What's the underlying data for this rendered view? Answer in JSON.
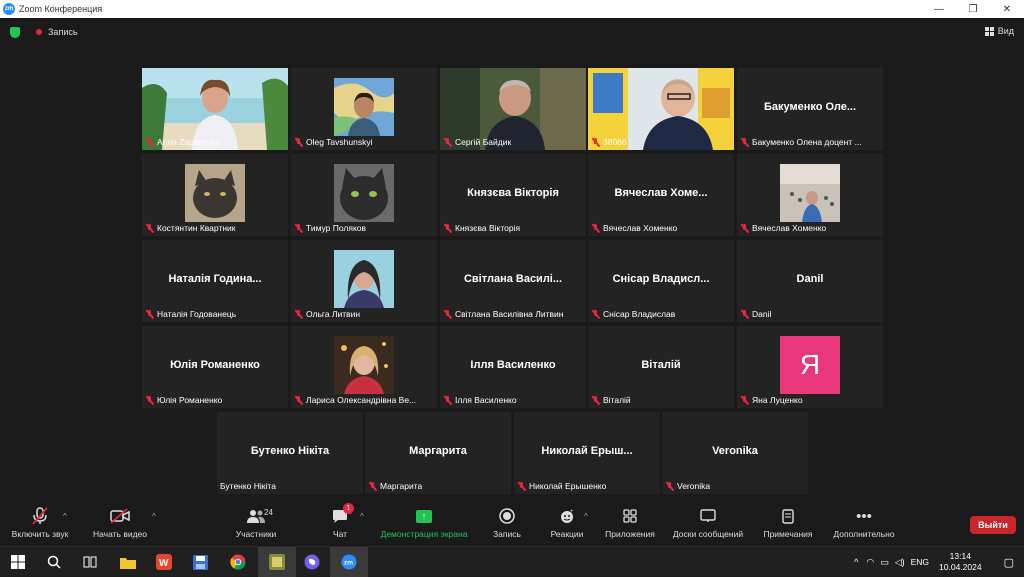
{
  "window": {
    "app_icon": "zm",
    "title": "Zoom Конференция",
    "controls": [
      "—",
      "❐",
      "✕"
    ]
  },
  "topbar": {
    "recording_label": "Запись",
    "view_label": "Вид"
  },
  "participants": [
    {
      "label": "Anna Zaparenko",
      "type": "video",
      "active": true
    },
    {
      "label": "Oleg Tavshunskyi",
      "type": "photo"
    },
    {
      "label": "Сергій Байдик",
      "type": "video"
    },
    {
      "label": "38066",
      "type": "video"
    },
    {
      "label": "Бакуменко Олена доцент ...",
      "type": "name",
      "display": "Бакуменко Оле..."
    },
    {
      "label": "Костянтин Квартник",
      "type": "photo"
    },
    {
      "label": "Тимур Поляков",
      "type": "photo"
    },
    {
      "label": "Князєва Вікторія",
      "type": "name",
      "display": "Князєва Вікторія"
    },
    {
      "label": "Вячеслав Хоменко",
      "type": "name",
      "display": "Вячеслав Хоме..."
    },
    {
      "label": "Вячеслав Хоменко",
      "type": "photo"
    },
    {
      "label": "Наталія Годованець",
      "type": "name",
      "display": "Наталія Година..."
    },
    {
      "label": "Ольга Литвин",
      "type": "photo"
    },
    {
      "label": "Світлана Василівна Литвин",
      "type": "name",
      "display": "Світлана Василі..."
    },
    {
      "label": "Снісар Владислав",
      "type": "name",
      "display": "Снісар Владисл..."
    },
    {
      "label": "Danil",
      "type": "name",
      "display": "Danil"
    },
    {
      "label": "Юлія Романенко",
      "type": "name",
      "display": "Юлія Романенко"
    },
    {
      "label": "Лариса Олександрівна Ве...",
      "type": "photo"
    },
    {
      "label": "Ілля Василенко",
      "type": "name",
      "display": "Ілля Василенко"
    },
    {
      "label": "Віталій",
      "type": "name",
      "display": "Віталій"
    },
    {
      "label": "Яна Луценко",
      "type": "letter",
      "letter": "Я"
    },
    {
      "label": "Бутенко Нікіта",
      "type": "name",
      "display": "Бутенко Нікіта"
    },
    {
      "label": "Маргарита",
      "type": "name",
      "display": "Маргарита"
    },
    {
      "label": "Николай Ерышенко",
      "type": "name",
      "display": "Николай Ерыш..."
    },
    {
      "label": "Veronika",
      "type": "name",
      "display": "Veronika"
    }
  ],
  "toolbar": {
    "unmute": "Включить звук",
    "start_video": "Начать видео",
    "participants": "Участники",
    "participants_count": "24",
    "chat": "Чат",
    "chat_badge": "1",
    "share_screen": "Демонстрация экрана",
    "record": "Запись",
    "reactions": "Реакции",
    "apps": "Приложения",
    "whiteboards": "Доски сообщений",
    "notes": "Примечания",
    "more": "Дополнительно",
    "leave": "Выйти"
  },
  "taskbar": {
    "language": "ENG",
    "time": "13:14",
    "date": "10.04.2024"
  },
  "colors": {
    "accent_green": "#23c552",
    "leave_red": "#c8262a",
    "active_speaker": "#c8d94a",
    "letter_avatar": "#e8377a"
  }
}
